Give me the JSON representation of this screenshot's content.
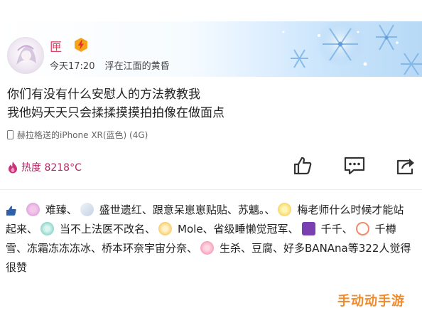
{
  "post": {
    "username": "匣",
    "time": "今天17:20",
    "location": "浮在江面的黄昏",
    "lines": [
      "你们有没有什么安慰人的方法教教我",
      "我他妈天天只会揉揉摸摸拍拍像在做面点"
    ],
    "device": "赫拉格送的iPhone XR(蓝色) (4G)",
    "heat": "热度 8218°C"
  },
  "actions": {
    "like_icon": "thumbs-up-icon",
    "comment_icon": "comment-icon",
    "share_icon": "share-icon"
  },
  "likes": {
    "users": [
      {
        "name": "难臻、",
        "color": "#e7a9d9"
      },
      {
        "name": "盛世遗红",
        "color": "#d9e3ef"
      },
      {
        "name": "、跟意呆崽崽贴贴、苏魑。、",
        "color": null
      },
      {
        "name": "梅老师什么时候才能站起来、",
        "color": "#f5d154"
      },
      {
        "name": "当不上法医不改名、",
        "color": "#7fd2c8"
      },
      {
        "name": "Mole、省级睡懒觉冠军、",
        "color": "#f4c34a"
      },
      {
        "name": "千千、",
        "color": "#7a3fb0"
      },
      {
        "name": "千樽雪、冻霜冻冻冻冰、桥本环奈宇宙分奈、",
        "color": "#f08a6a"
      },
      {
        "name": "生杀、豆腐、好多BANAna等322人觉得很赞",
        "color": "#f29ab5"
      }
    ]
  },
  "watermark": "手动动手游",
  "colors": {
    "username": "#e23d62",
    "heat": "#b22a62",
    "watermark": "#f08a2a",
    "like_thumb": "#2e5fa8"
  }
}
